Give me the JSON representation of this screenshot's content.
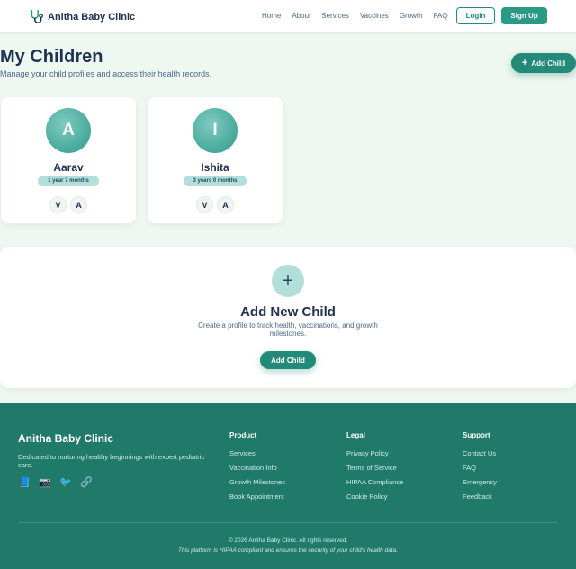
{
  "header": {
    "brand": "Anitha Baby Clinic",
    "nav": [
      "Home",
      "About",
      "Services",
      "Vaccines",
      "Growth",
      "FAQ"
    ],
    "login_label": "Login",
    "signup_label": "Sign Up"
  },
  "page": {
    "title": "My Children",
    "subtitle": "Manage your child profiles and access their health records.",
    "add_child_label": "Add Child"
  },
  "children": [
    {
      "initial": "A",
      "name": "Aarav",
      "age": "1 year 7 months",
      "chips": [
        "V",
        "A"
      ]
    },
    {
      "initial": "I",
      "name": "Ishita",
      "age": "3 years 0 months",
      "chips": [
        "V",
        "A"
      ]
    }
  ],
  "add_panel": {
    "plus": "+",
    "title": "Add New Child",
    "description": "Create a profile to track health, vaccinations, and growth milestones.",
    "button_label": "Add Child"
  },
  "footer": {
    "brand": "Anitha Baby Clinic",
    "tagline": "Dedicated to nurturing healthy beginnings with expert pediatric care.",
    "social_icons": [
      "book-icon",
      "camera-icon",
      "bird-icon",
      "link-icon"
    ],
    "columns": [
      {
        "heading": "Product",
        "links": [
          "Services",
          "Vaccination Info",
          "Growth Milestones",
          "Book Appointment"
        ]
      },
      {
        "heading": "Legal",
        "links": [
          "Privacy Policy",
          "Terms of Service",
          "HIPAA Compliance",
          "Cookie Policy"
        ]
      },
      {
        "heading": "Support",
        "links": [
          "Contact Us",
          "FAQ",
          "Emergency",
          "Feedback"
        ]
      }
    ],
    "copyright": "© 2026 Anitha Baby Clinic. All rights reserved.",
    "note": "This platform is HIPAA compliant and ensures the security of your child's health data."
  },
  "colors": {
    "accent": "#238a7a",
    "page_bg": "#eef7f0",
    "footer_bg": "#1f7a6a",
    "heading": "#1e3150"
  }
}
